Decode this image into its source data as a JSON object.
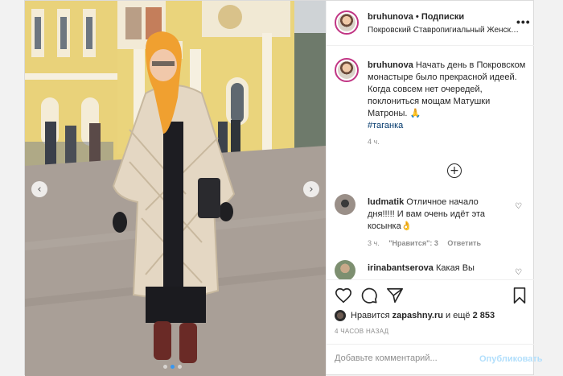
{
  "post": {
    "username": "bruhunova",
    "dot": "•",
    "follow_label": "Подписки",
    "location": "Покровский Ставропигиальный Женский М...",
    "more_label": "•••"
  },
  "caption": {
    "username": "bruhunova",
    "text": "Начать день в Покровском монастыре было прекрасной идеей. Когда совсем нет очередей, поклониться мощам Матушки Матроны.",
    "emoji": "🙏",
    "hashtag": "#таганка",
    "time": "4 ч."
  },
  "load_more_label": "+",
  "comments": [
    {
      "username": "ludmatik",
      "text": "Отличное начало дня!!!!! И вам очень идёт эта косынка👌",
      "time": "3 ч.",
      "likes": "\"Нравится\": 3",
      "reply": "Ответить"
    },
    {
      "username": "irinabantserova",
      "text": "Какая Вы"
    }
  ],
  "likes": {
    "prefix": "Нравится",
    "user": "zapashny.ru",
    "suffix": "и ещё",
    "count": "2 853"
  },
  "time_ago": "4 ЧАСОВ НАЗАД",
  "comment_box": {
    "placeholder": "Добавьте комментарий...",
    "post_label": "Опубликовать"
  },
  "carousel": {
    "prev": "‹",
    "next": "›",
    "slide_count": 3,
    "active_index": 1
  },
  "colors": {
    "accent": "#3897f0",
    "hashtag": "#00376b",
    "post_disabled": "#b2dffc",
    "story_ring": "#c13584"
  },
  "icons": [
    "heart-icon",
    "comment-icon",
    "share-icon",
    "bookmark-icon",
    "more-icon",
    "add-circle-icon",
    "chevron-left-icon",
    "chevron-right-icon"
  ]
}
